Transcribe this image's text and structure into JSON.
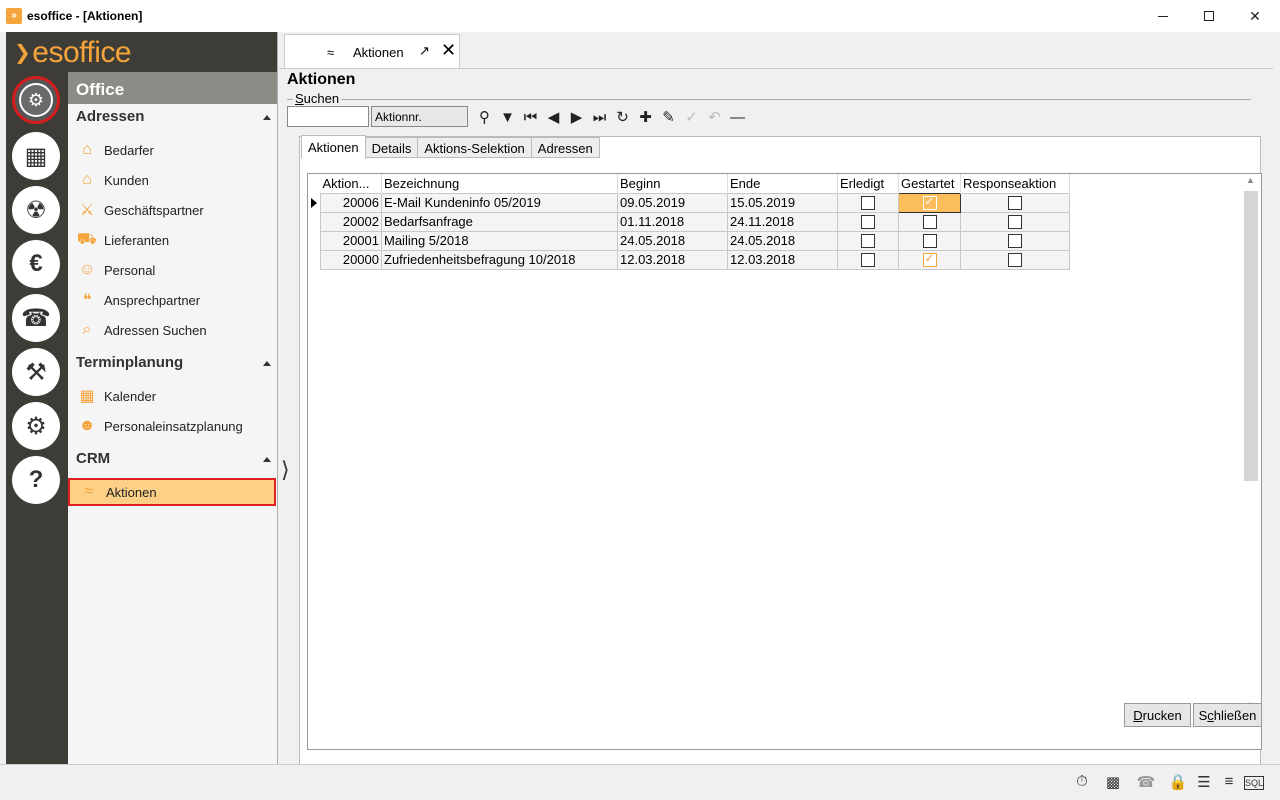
{
  "window": {
    "title": "esoffice - [Aktionen]",
    "minimize": "—",
    "maximize": "□",
    "close": "✕"
  },
  "brand": {
    "logo_text": "esoffice",
    "accent": "#f5a33b"
  },
  "rail": {
    "buttons": [
      {
        "name": "office-gear-icon",
        "glyph": "⚙",
        "active": true
      },
      {
        "name": "planner-grid-icon",
        "glyph": "▦"
      },
      {
        "name": "alarm-light-icon",
        "glyph": "☢"
      },
      {
        "name": "euro-icon",
        "glyph": "€"
      },
      {
        "name": "headset-icon",
        "glyph": "☎"
      },
      {
        "name": "tools-icon",
        "glyph": "⚒"
      },
      {
        "name": "settings-gears-icon",
        "glyph": "⚙"
      },
      {
        "name": "help-question-icon",
        "glyph": "?"
      }
    ]
  },
  "nav": {
    "header": "Office",
    "sections": [
      {
        "title": "Adressen",
        "items": [
          {
            "label": "Bedarfer",
            "icon": "house-icon",
            "glyph": "⌂"
          },
          {
            "label": "Kunden",
            "icon": "home-icon",
            "glyph": "⌂"
          },
          {
            "label": "Geschäftspartner",
            "icon": "handshake-icon",
            "glyph": "⚔"
          },
          {
            "label": "Lieferanten",
            "icon": "truck-icon",
            "glyph": "⛟"
          },
          {
            "label": "Personal",
            "icon": "people-icon",
            "glyph": "☺"
          },
          {
            "label": "Ansprechpartner",
            "icon": "speech-bubble-icon",
            "glyph": "❝"
          },
          {
            "label": "Adressen Suchen",
            "icon": "address-search-icon",
            "glyph": "⌕"
          }
        ]
      },
      {
        "title": "Terminplanung",
        "items": [
          {
            "label": "Kalender",
            "icon": "calendar-icon",
            "glyph": "▦"
          },
          {
            "label": "Personaleinsatzplanung",
            "icon": "staff-plan-icon",
            "glyph": "☻"
          }
        ]
      },
      {
        "title": "CRM",
        "items": [
          {
            "label": "Aktionen",
            "icon": "tornado-icon",
            "glyph": "≈",
            "selected": true
          }
        ]
      }
    ]
  },
  "doc_tab": {
    "label": "Aktionen"
  },
  "page": {
    "title": "Aktionen",
    "search_label_prefix": "S",
    "search_label_rest": "uchen",
    "search_field": "Aktionnr."
  },
  "inner_tabs": [
    {
      "label": "Aktionen",
      "active": true
    },
    {
      "label": "Details"
    },
    {
      "label": "Aktions-Selektion"
    },
    {
      "label": "Adressen"
    }
  ],
  "grid": {
    "columns": [
      "Aktion...",
      "Bezeichnung",
      "Beginn",
      "Ende",
      "Erledigt",
      "Gestartet",
      "Responseaktion"
    ],
    "rows": [
      {
        "nr": "20006",
        "bez": "E-Mail Kundeninfo 05/2019",
        "beginn": "09.05.2019",
        "ende": "15.05.2019",
        "erledigt": false,
        "gestartet": true,
        "response": false
      },
      {
        "nr": "20002",
        "bez": "Bedarfsanfrage",
        "beginn": "01.11.2018",
        "ende": "24.11.2018",
        "erledigt": false,
        "gestartet": false,
        "response": false
      },
      {
        "nr": "20001",
        "bez": "Mailing 5/2018",
        "beginn": "24.05.2018",
        "ende": "24.05.2018",
        "erledigt": false,
        "gestartet": false,
        "response": false
      },
      {
        "nr": "20000",
        "bez": "Zufriedenheitsbefragung 10/2018",
        "beginn": "12.03.2018",
        "ende": "12.03.2018",
        "erledigt": false,
        "gestartet": true,
        "response": false
      }
    ]
  },
  "buttons": {
    "print_u": "D",
    "print_rest": "rucken",
    "close_u": "c",
    "close_pre": "S",
    "close_rest": "hließen"
  }
}
